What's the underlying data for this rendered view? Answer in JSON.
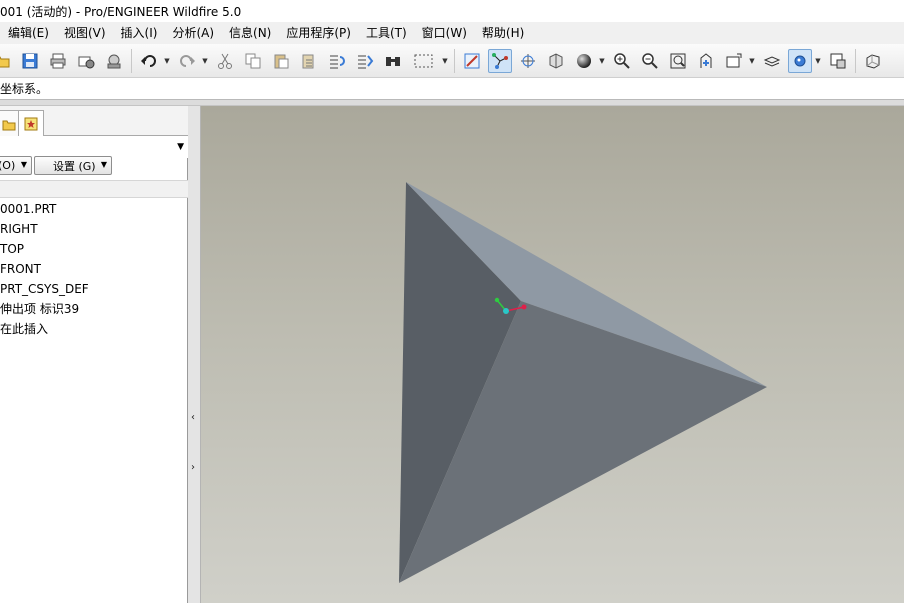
{
  "window": {
    "title": "001 (活动的) - Pro/ENGINEER Wildfire 5.0"
  },
  "menu": [
    {
      "label": "编辑(E)"
    },
    {
      "label": "视图(V)"
    },
    {
      "label": "插入(I)"
    },
    {
      "label": "分析(A)"
    },
    {
      "label": "信息(N)"
    },
    {
      "label": "应用程序(P)"
    },
    {
      "label": "工具(T)"
    },
    {
      "label": "窗口(W)"
    },
    {
      "label": "帮助(H)"
    }
  ],
  "message": "坐标系。",
  "panel": {
    "filter_button": "(O)",
    "settings_button": "设置 (G)"
  },
  "model_tree": [
    {
      "label": "0001.PRT"
    },
    {
      "label": "RIGHT"
    },
    {
      "label": "TOP"
    },
    {
      "label": "FRONT"
    },
    {
      "label": "PRT_CSYS_DEF"
    },
    {
      "label": "伸出项 标识39"
    },
    {
      "label": "在此插入"
    }
  ],
  "colors": {
    "accent": "#3b6fc4",
    "viewport_top": "#aaa89b",
    "viewport_bottom": "#d0d0c9",
    "model_light": "#8f99a4",
    "model_mid": "#6b7178",
    "model_dark": "#585e65"
  },
  "icons": [
    "open-icon",
    "save-icon",
    "print-icon",
    "send-mail-icon",
    "mail-icon",
    "undo-icon",
    "redo-icon",
    "cut-icon",
    "copy-icon",
    "paste-icon",
    "paste-special-icon",
    "regenerate-icon",
    "regen-manager-icon",
    "find-icon",
    "select-box-icon",
    "repaint-icon",
    "spin-center-icon",
    "orient-icon",
    "saved-views-icon",
    "shading-icon",
    "zoom-in-icon",
    "zoom-out-icon",
    "refit-icon",
    "reorient-icon",
    "view-manager-icon",
    "layers-icon",
    "display-style-icon",
    "wireframe-icon",
    "hidden-line-icon"
  ]
}
